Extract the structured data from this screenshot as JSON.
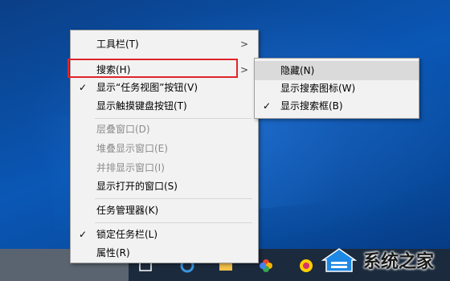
{
  "context_menu": {
    "items": [
      {
        "label": "工具栏(T)",
        "has_submenu": true
      },
      {
        "label": "搜索(H)",
        "has_submenu": true
      },
      {
        "label": "显示“任务视图”按钮(V)",
        "checked": true
      },
      {
        "label": "显示触摸键盘按钮(T)"
      },
      {
        "label": "层叠窗口(D)",
        "disabled": true
      },
      {
        "label": "堆叠显示窗口(E)",
        "disabled": true
      },
      {
        "label": "并排显示窗口(I)",
        "disabled": true
      },
      {
        "label": "显示打开的窗口(S)"
      },
      {
        "label": "任务管理器(K)"
      },
      {
        "label": "锁定任务栏(L)",
        "checked": true
      },
      {
        "label": "属性(R)"
      }
    ]
  },
  "search_submenu": {
    "items": [
      {
        "label": "隐藏(N)"
      },
      {
        "label": "显示搜索图标(W)"
      },
      {
        "label": "显示搜索框(B)",
        "checked": true
      }
    ]
  },
  "glyphs": {
    "check": "✓",
    "arrow": ">"
  },
  "watermark": {
    "text": "系统之家"
  },
  "colors": {
    "highlight_box": "#e0242a",
    "menu_bg": "#f2f2f2"
  }
}
